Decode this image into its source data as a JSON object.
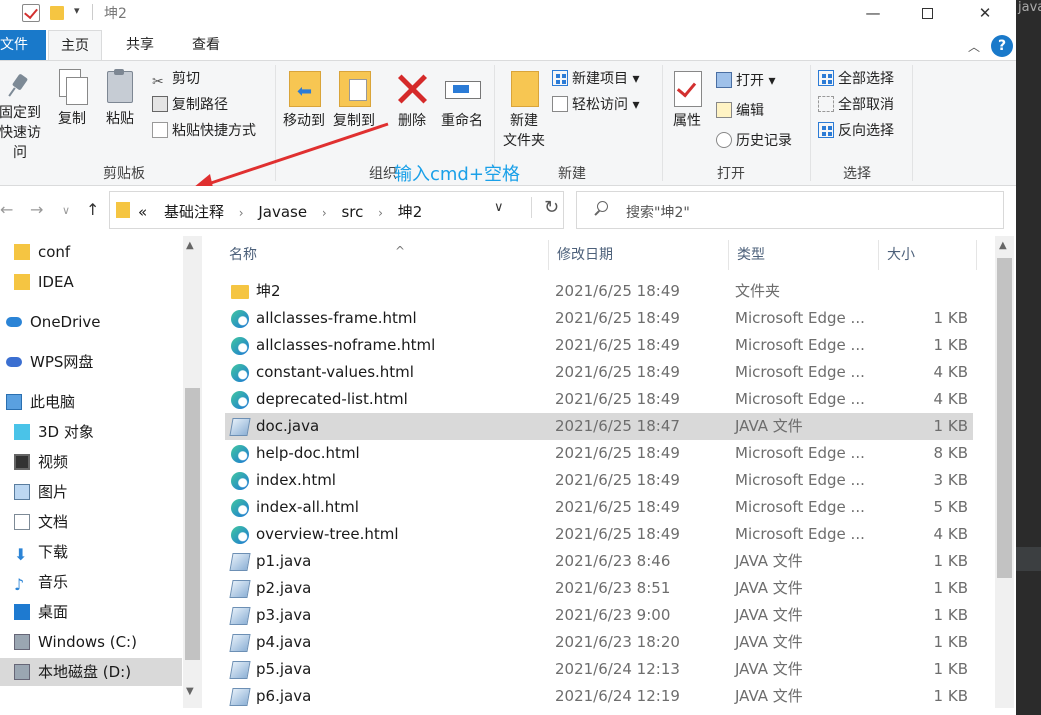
{
  "window": {
    "title": "坤2",
    "minimize": "—",
    "maximize": "",
    "close": "✕",
    "side_label": "java"
  },
  "tabs": {
    "file": "文件",
    "home": "主页",
    "share": "共享",
    "view": "查看",
    "collapse": "︿",
    "help": "?"
  },
  "ribbon": {
    "clipboard": {
      "group": "剪贴板",
      "pin_line1": "固定到",
      "pin_line2": "快速访问",
      "copy": "复制",
      "paste": "粘贴",
      "cut": "剪切",
      "copy_path": "复制路径",
      "paste_shortcut": "粘贴快捷方式"
    },
    "organize": {
      "group": "组织",
      "move_to": "移动到",
      "copy_to": "复制到",
      "delete": "删除",
      "rename": "重命名"
    },
    "new": {
      "group": "新建",
      "new_folder_line1": "新建",
      "new_folder_line2": "文件夹",
      "new_item": "新建项目 ▾",
      "easy_access": "轻松访问 ▾"
    },
    "open": {
      "group": "打开",
      "properties": "属性",
      "open": "打开 ▾",
      "edit": "编辑",
      "history": "历史记录"
    },
    "select": {
      "group": "选择",
      "select_all": "全部选择",
      "select_none": "全部取消",
      "invert": "反向选择"
    }
  },
  "annotation": {
    "text": "输入cmd+空格",
    "color": "#1aa0e8",
    "arrow_color": "#e03030"
  },
  "address": {
    "back": "←",
    "forward": "→",
    "recent": "∨",
    "up": "↑",
    "overflow": "«",
    "path": [
      "基础注释",
      "Javase",
      "src",
      "坤2"
    ],
    "separator": "›",
    "dropdown": "∨",
    "refresh": "↻"
  },
  "search": {
    "placeholder": "搜索\"坤2\""
  },
  "navpane": {
    "items": [
      {
        "label": "conf",
        "icon": "folder-icon"
      },
      {
        "label": "IDEA",
        "icon": "folder-icon"
      },
      {
        "label": "OneDrive",
        "icon": "onedrive-icon"
      },
      {
        "label": "WPS网盘",
        "icon": "wps-cloud-icon"
      },
      {
        "label": "此电脑",
        "icon": "this-pc-icon"
      },
      {
        "label": "3D 对象",
        "icon": "3d-objects-icon"
      },
      {
        "label": "视频",
        "icon": "video-icon"
      },
      {
        "label": "图片",
        "icon": "pictures-icon"
      },
      {
        "label": "文档",
        "icon": "documents-icon"
      },
      {
        "label": "下载",
        "icon": "downloads-icon"
      },
      {
        "label": "音乐",
        "icon": "music-icon"
      },
      {
        "label": "桌面",
        "icon": "desktop-icon"
      },
      {
        "label": "Windows (C:)",
        "icon": "drive-icon"
      },
      {
        "label": "本地磁盘 (D:)",
        "icon": "drive-icon"
      }
    ],
    "scroll_up": "▲",
    "scroll_down": "▼"
  },
  "columns": {
    "name": "名称",
    "date": "修改日期",
    "type": "类型",
    "size": "大小",
    "sort_caret": "^"
  },
  "files": [
    {
      "name": "坤2",
      "date": "2021/6/25 18:49",
      "type": "文件夹",
      "size": "",
      "kind": "folder"
    },
    {
      "name": "allclasses-frame.html",
      "date": "2021/6/25 18:49",
      "type": "Microsoft Edge ...",
      "size": "1 KB",
      "kind": "edge"
    },
    {
      "name": "allclasses-noframe.html",
      "date": "2021/6/25 18:49",
      "type": "Microsoft Edge ...",
      "size": "1 KB",
      "kind": "edge"
    },
    {
      "name": "constant-values.html",
      "date": "2021/6/25 18:49",
      "type": "Microsoft Edge ...",
      "size": "4 KB",
      "kind": "edge"
    },
    {
      "name": "deprecated-list.html",
      "date": "2021/6/25 18:49",
      "type": "Microsoft Edge ...",
      "size": "4 KB",
      "kind": "edge"
    },
    {
      "name": "doc.java",
      "date": "2021/6/25 18:47",
      "type": "JAVA 文件",
      "size": "1 KB",
      "kind": "java"
    },
    {
      "name": "help-doc.html",
      "date": "2021/6/25 18:49",
      "type": "Microsoft Edge ...",
      "size": "8 KB",
      "kind": "edge"
    },
    {
      "name": "index.html",
      "date": "2021/6/25 18:49",
      "type": "Microsoft Edge ...",
      "size": "3 KB",
      "kind": "edge"
    },
    {
      "name": "index-all.html",
      "date": "2021/6/25 18:49",
      "type": "Microsoft Edge ...",
      "size": "5 KB",
      "kind": "edge"
    },
    {
      "name": "overview-tree.html",
      "date": "2021/6/25 18:49",
      "type": "Microsoft Edge ...",
      "size": "4 KB",
      "kind": "edge"
    },
    {
      "name": "p1.java",
      "date": "2021/6/23 8:46",
      "type": "JAVA 文件",
      "size": "1 KB",
      "kind": "java"
    },
    {
      "name": "p2.java",
      "date": "2021/6/23 8:51",
      "type": "JAVA 文件",
      "size": "1 KB",
      "kind": "java"
    },
    {
      "name": "p3.java",
      "date": "2021/6/23 9:00",
      "type": "JAVA 文件",
      "size": "1 KB",
      "kind": "java"
    },
    {
      "name": "p4.java",
      "date": "2021/6/23 18:20",
      "type": "JAVA 文件",
      "size": "1 KB",
      "kind": "java"
    },
    {
      "name": "p5.java",
      "date": "2021/6/24 12:13",
      "type": "JAVA 文件",
      "size": "1 KB",
      "kind": "java"
    },
    {
      "name": "p6.java",
      "date": "2021/6/24 12:19",
      "type": "JAVA 文件",
      "size": "1 KB",
      "kind": "java"
    }
  ],
  "colors": {
    "accent": "#1979ca",
    "selection": "#cce8ff",
    "highlight_row": "#d9d9d9"
  }
}
